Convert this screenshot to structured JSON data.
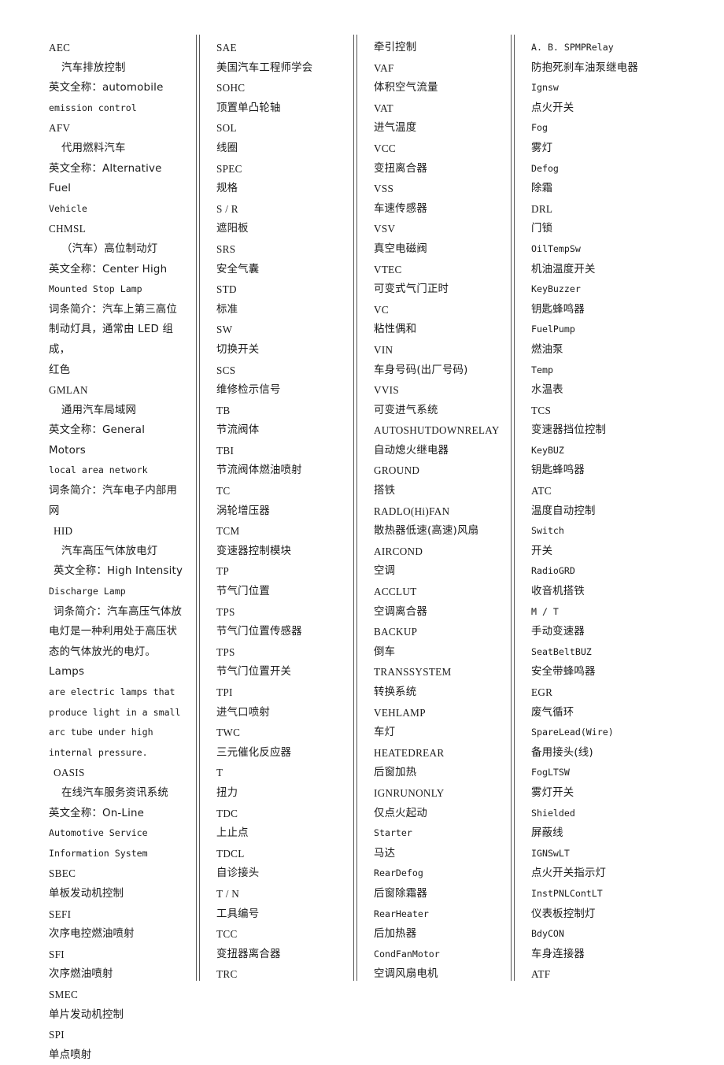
{
  "document": {
    "type": "glossary",
    "title": "汽车英文缩写词汇表",
    "column_count": 4
  },
  "columns": [
    {
      "id": "column-1",
      "lines": [
        {
          "text": "AEC",
          "style": "term",
          "indent": 1
        },
        {
          "text": "汽车排放控制",
          "style": "cn",
          "indent": 2
        },
        {
          "text": "英文全称：automobile",
          "style": "mixed",
          "indent": 1
        },
        {
          "text": "emission control",
          "style": "mono",
          "indent": 1
        },
        {
          "text": "AFV",
          "style": "term",
          "indent": 1
        },
        {
          "text": "代用燃料汽车",
          "style": "cn",
          "indent": 2
        },
        {
          "text": "英文全称：Alternative Fuel",
          "style": "mixed",
          "indent": 1
        },
        {
          "text": "Vehicle",
          "style": "mono",
          "indent": 1
        },
        {
          "text": "CHMSL",
          "style": "term",
          "indent": 1
        },
        {
          "text": "（汽车）高位制动灯",
          "style": "cn",
          "indent": 2
        },
        {
          "text": "英文全称：Center High",
          "style": "mixed",
          "indent": 1
        },
        {
          "text": "Mounted Stop Lamp",
          "style": "mono",
          "indent": 1
        },
        {
          "text": "词条简介：汽车上第三高位",
          "style": "cn",
          "indent": 1
        },
        {
          "text": "制动灯具，通常由 LED 组成，",
          "style": "cn",
          "indent": 1
        },
        {
          "text": "红色",
          "style": "cn",
          "indent": 1
        },
        {
          "text": "GMLAN",
          "style": "term",
          "indent": 1
        },
        {
          "text": "通用汽车局域网",
          "style": "cn",
          "indent": 2
        },
        {
          "text": "英文全称：General Motors",
          "style": "mixed",
          "indent": 1
        },
        {
          "text": "local area network",
          "style": "mono",
          "indent": 1
        },
        {
          "text": "词条简介：汽车电子内部用",
          "style": "cn",
          "indent": 1
        },
        {
          "text": "网",
          "style": "cn",
          "indent": 1
        },
        {
          "text": "HID",
          "style": "term",
          "indent": 3
        },
        {
          "text": "汽车高压气体放电灯",
          "style": "cn",
          "indent": 2
        },
        {
          "text": "英文全称：High Intensity",
          "style": "mixed",
          "indent": 3
        },
        {
          "text": "Discharge Lamp",
          "style": "mono",
          "indent": 1
        },
        {
          "text": "词条简介：汽车高压气体放",
          "style": "cn",
          "indent": 3
        },
        {
          "text": "电灯是一种利用处于高压状",
          "style": "cn",
          "indent": 1
        },
        {
          "text": "态的气体放光的电灯。Lamps",
          "style": "cn",
          "indent": 1
        },
        {
          "text": "are electric lamps that",
          "style": "mono",
          "indent": 1
        },
        {
          "text": "produce light in a small",
          "style": "mono",
          "indent": 1
        },
        {
          "text": "arc tube under high",
          "style": "mono",
          "indent": 1
        },
        {
          "text": "internal pressure.",
          "style": "mono",
          "indent": 1
        },
        {
          "text": "OASIS",
          "style": "term",
          "indent": 3
        },
        {
          "text": "在线汽车服务资讯系统",
          "style": "cn",
          "indent": 2
        },
        {
          "text": "英文全称：On-Line",
          "style": "mixed",
          "indent": 1
        },
        {
          "text": "Automotive Service",
          "style": "mono",
          "indent": 1
        },
        {
          "text": "Information System",
          "style": "mono",
          "indent": 1
        },
        {
          "text": "SBEC",
          "style": "term",
          "indent": 1
        },
        {
          "text": "单板发动机控制",
          "style": "cn",
          "indent": 1
        },
        {
          "text": "SEFI",
          "style": "term",
          "indent": 1
        },
        {
          "text": "次序电控燃油喷射",
          "style": "cn",
          "indent": 1
        },
        {
          "text": "SFI",
          "style": "term",
          "indent": 1
        },
        {
          "text": "次序燃油喷射",
          "style": "cn",
          "indent": 1
        },
        {
          "text": "SMEC",
          "style": "term",
          "indent": 1
        },
        {
          "text": "单片发动机控制",
          "style": "cn",
          "indent": 1
        },
        {
          "text": "SPI",
          "style": "term",
          "indent": 1
        },
        {
          "text": "单点喷射",
          "style": "cn",
          "indent": 1
        }
      ]
    },
    {
      "id": "column-2",
      "lines": [
        {
          "text": "SAE",
          "style": "term",
          "indent": 1
        },
        {
          "text": "美国汽车工程师学会",
          "style": "cn",
          "indent": 1
        },
        {
          "text": "SOHC",
          "style": "term",
          "indent": 1
        },
        {
          "text": "顶置单凸轮轴",
          "style": "cn",
          "indent": 1
        },
        {
          "text": "SOL",
          "style": "term",
          "indent": 1
        },
        {
          "text": "线圈",
          "style": "cn",
          "indent": 1
        },
        {
          "text": "SPEC",
          "style": "term",
          "indent": 1
        },
        {
          "text": "规格",
          "style": "cn",
          "indent": 1
        },
        {
          "text": "S / R",
          "style": "term",
          "indent": 1
        },
        {
          "text": "遮阳板",
          "style": "cn",
          "indent": 1
        },
        {
          "text": "SRS",
          "style": "term",
          "indent": 1
        },
        {
          "text": "安全气囊",
          "style": "cn",
          "indent": 1
        },
        {
          "text": "STD",
          "style": "term",
          "indent": 1
        },
        {
          "text": "标准",
          "style": "cn",
          "indent": 1
        },
        {
          "text": "SW",
          "style": "term",
          "indent": 1
        },
        {
          "text": "切换开关",
          "style": "cn",
          "indent": 1
        },
        {
          "text": "SCS",
          "style": "term",
          "indent": 1
        },
        {
          "text": "维修检示信号",
          "style": "cn",
          "indent": 1
        },
        {
          "text": "TB",
          "style": "term",
          "indent": 1
        },
        {
          "text": "节流阀体",
          "style": "cn",
          "indent": 1
        },
        {
          "text": "TBI",
          "style": "term",
          "indent": 1
        },
        {
          "text": "节流阀体燃油喷射",
          "style": "cn",
          "indent": 1
        },
        {
          "text": "TC",
          "style": "term",
          "indent": 1
        },
        {
          "text": "涡轮增压器",
          "style": "cn",
          "indent": 1
        },
        {
          "text": "TCM",
          "style": "term",
          "indent": 1
        },
        {
          "text": "变速器控制模块",
          "style": "cn",
          "indent": 1
        },
        {
          "text": "TP",
          "style": "term",
          "indent": 1
        },
        {
          "text": "节气门位置",
          "style": "cn",
          "indent": 1
        },
        {
          "text": "TPS",
          "style": "term",
          "indent": 1
        },
        {
          "text": "节气门位置传感器",
          "style": "cn",
          "indent": 1
        },
        {
          "text": "TPS",
          "style": "term",
          "indent": 1
        },
        {
          "text": "节气门位置开关",
          "style": "cn",
          "indent": 1
        },
        {
          "text": "TPI",
          "style": "term",
          "indent": 1
        },
        {
          "text": "进气口喷射",
          "style": "cn",
          "indent": 1
        },
        {
          "text": "TWC",
          "style": "term",
          "indent": 1
        },
        {
          "text": "三元催化反应器",
          "style": "cn",
          "indent": 1
        },
        {
          "text": "T",
          "style": "term",
          "indent": 1
        },
        {
          "text": "扭力",
          "style": "cn",
          "indent": 1
        },
        {
          "text": "TDC",
          "style": "term",
          "indent": 1
        },
        {
          "text": "上止点",
          "style": "cn",
          "indent": 1
        },
        {
          "text": "TDCL",
          "style": "term",
          "indent": 1
        },
        {
          "text": "自诊接头",
          "style": "cn",
          "indent": 1
        },
        {
          "text": "T / N",
          "style": "term",
          "indent": 1
        },
        {
          "text": "工具编号",
          "style": "cn",
          "indent": 1
        },
        {
          "text": "TCC",
          "style": "term",
          "indent": 1
        },
        {
          "text": "变扭器离合器",
          "style": "cn",
          "indent": 1
        },
        {
          "text": "TRC",
          "style": "term",
          "indent": 1
        }
      ]
    },
    {
      "id": "column-3",
      "lines": [
        {
          "text": "牵引控制",
          "style": "cn",
          "indent": 1
        },
        {
          "text": "VAF",
          "style": "term",
          "indent": 1
        },
        {
          "text": "体积空气流量",
          "style": "cn",
          "indent": 1
        },
        {
          "text": "VAT",
          "style": "term",
          "indent": 1
        },
        {
          "text": "进气温度",
          "style": "cn",
          "indent": 1
        },
        {
          "text": "VCC",
          "style": "term",
          "indent": 1
        },
        {
          "text": "变扭离合器",
          "style": "cn",
          "indent": 1
        },
        {
          "text": "VSS",
          "style": "term",
          "indent": 1
        },
        {
          "text": "车速传感器",
          "style": "cn",
          "indent": 1
        },
        {
          "text": "VSV",
          "style": "term",
          "indent": 1
        },
        {
          "text": "真空电磁阀",
          "style": "cn",
          "indent": 1
        },
        {
          "text": "VTEC",
          "style": "term",
          "indent": 1
        },
        {
          "text": "可变式气门正时",
          "style": "cn",
          "indent": 1
        },
        {
          "text": "VC",
          "style": "term",
          "indent": 1
        },
        {
          "text": "粘性偶和",
          "style": "cn",
          "indent": 1
        },
        {
          "text": "VIN",
          "style": "term",
          "indent": 1
        },
        {
          "text": "车身号码(出厂号码)",
          "style": "cn",
          "indent": 1
        },
        {
          "text": "VVIS",
          "style": "term",
          "indent": 1
        },
        {
          "text": "可变进气系统",
          "style": "cn",
          "indent": 1
        },
        {
          "text": "AUTOSHUTDOWNRELAY",
          "style": "term",
          "indent": 1
        },
        {
          "text": "自动熄火继电器",
          "style": "cn",
          "indent": 1
        },
        {
          "text": "GROUND",
          "style": "term",
          "indent": 1
        },
        {
          "text": "搭铁",
          "style": "cn",
          "indent": 1
        },
        {
          "text": "RADLO(Hi)FAN",
          "style": "term",
          "indent": 1
        },
        {
          "text": "散热器低速(高速)风扇",
          "style": "cn",
          "indent": 1
        },
        {
          "text": "AIRCOND",
          "style": "term",
          "indent": 1
        },
        {
          "text": "空调",
          "style": "cn",
          "indent": 1
        },
        {
          "text": "ACCLUT",
          "style": "term",
          "indent": 1
        },
        {
          "text": "空调离合器",
          "style": "cn",
          "indent": 1
        },
        {
          "text": "BACKUP",
          "style": "term",
          "indent": 1
        },
        {
          "text": "倒车",
          "style": "cn",
          "indent": 1
        },
        {
          "text": "TRANSSYSTEM",
          "style": "term",
          "indent": 1
        },
        {
          "text": "转换系统",
          "style": "cn",
          "indent": 1
        },
        {
          "text": "VEHLAMP",
          "style": "term",
          "indent": 1
        },
        {
          "text": "车灯",
          "style": "cn",
          "indent": 1
        },
        {
          "text": "HEATEDREAR",
          "style": "term",
          "indent": 1
        },
        {
          "text": "后窗加热",
          "style": "cn",
          "indent": 1
        },
        {
          "text": "IGNRUNONLY",
          "style": "term",
          "indent": 1
        },
        {
          "text": "仅点火起动",
          "style": "cn",
          "indent": 1
        },
        {
          "text": "Starter",
          "style": "mono",
          "indent": 1
        },
        {
          "text": "马达",
          "style": "cn",
          "indent": 1
        },
        {
          "text": "RearDefog",
          "style": "mono",
          "indent": 1
        },
        {
          "text": "后窗除霜器",
          "style": "cn",
          "indent": 1
        },
        {
          "text": "RearHeater",
          "style": "mono",
          "indent": 1
        },
        {
          "text": "后加热器",
          "style": "cn",
          "indent": 1
        },
        {
          "text": "CondFanMotor",
          "style": "mono",
          "indent": 1
        },
        {
          "text": "空调风扇电机",
          "style": "cn",
          "indent": 1
        }
      ]
    },
    {
      "id": "column-4",
      "lines": [
        {
          "text": "A. B. SPMPRelay",
          "style": "mono",
          "indent": 1
        },
        {
          "text": "防抱死刹车油泵继电器",
          "style": "cn",
          "indent": 1
        },
        {
          "text": "Ignsw",
          "style": "mono",
          "indent": 1
        },
        {
          "text": "点火开关",
          "style": "cn",
          "indent": 1
        },
        {
          "text": "Fog",
          "style": "mono",
          "indent": 1
        },
        {
          "text": "雾灯",
          "style": "cn",
          "indent": 1
        },
        {
          "text": "Defog",
          "style": "mono",
          "indent": 1
        },
        {
          "text": "除霜",
          "style": "cn",
          "indent": 1
        },
        {
          "text": "DRL",
          "style": "term",
          "indent": 1
        },
        {
          "text": "门锁",
          "style": "cn",
          "indent": 1
        },
        {
          "text": "OilTempSw",
          "style": "mono",
          "indent": 1
        },
        {
          "text": "机油温度开关",
          "style": "cn",
          "indent": 1
        },
        {
          "text": "KeyBuzzer",
          "style": "mono",
          "indent": 1
        },
        {
          "text": "钥匙蜂鸣器",
          "style": "cn",
          "indent": 1
        },
        {
          "text": "FuelPump",
          "style": "mono",
          "indent": 1
        },
        {
          "text": "燃油泵",
          "style": "cn",
          "indent": 1
        },
        {
          "text": "Temp",
          "style": "mono",
          "indent": 1
        },
        {
          "text": "水温表",
          "style": "cn",
          "indent": 1
        },
        {
          "text": "TCS",
          "style": "term",
          "indent": 1
        },
        {
          "text": "变速器挡位控制",
          "style": "cn",
          "indent": 1
        },
        {
          "text": "KeyBUZ",
          "style": "mono",
          "indent": 1
        },
        {
          "text": "钥匙蜂鸣器",
          "style": "cn",
          "indent": 1
        },
        {
          "text": "ATC",
          "style": "term",
          "indent": 1
        },
        {
          "text": "温度自动控制",
          "style": "cn",
          "indent": 1
        },
        {
          "text": "Switch",
          "style": "mono",
          "indent": 1
        },
        {
          "text": "开关",
          "style": "cn",
          "indent": 1
        },
        {
          "text": "RadioGRD",
          "style": "mono",
          "indent": 1
        },
        {
          "text": "收音机搭铁",
          "style": "cn",
          "indent": 1
        },
        {
          "text": "M / T",
          "style": "mono",
          "indent": 1
        },
        {
          "text": "手动变速器",
          "style": "cn",
          "indent": 1
        },
        {
          "text": "SeatBeltBUZ",
          "style": "mono",
          "indent": 1
        },
        {
          "text": "安全带蜂鸣器",
          "style": "cn",
          "indent": 1
        },
        {
          "text": "EGR",
          "style": "term",
          "indent": 1
        },
        {
          "text": "废气循环",
          "style": "cn",
          "indent": 1
        },
        {
          "text": "SpareLead(Wire)",
          "style": "mono",
          "indent": 1
        },
        {
          "text": "备用接头(线)",
          "style": "cn",
          "indent": 1
        },
        {
          "text": "FogLTSW",
          "style": "mono",
          "indent": 1
        },
        {
          "text": "雾灯开关",
          "style": "cn",
          "indent": 1
        },
        {
          "text": "Shielded",
          "style": "mono",
          "indent": 1
        },
        {
          "text": "屏蔽线",
          "style": "cn",
          "indent": 1
        },
        {
          "text": "IGNSwLT",
          "style": "mono",
          "indent": 1
        },
        {
          "text": "点火开关指示灯",
          "style": "cn",
          "indent": 1
        },
        {
          "text": "InstPNLContLT",
          "style": "mono",
          "indent": 1
        },
        {
          "text": "仪表板控制灯",
          "style": "cn",
          "indent": 1
        },
        {
          "text": "BdyCON",
          "style": "mono",
          "indent": 1
        },
        {
          "text": "车身连接器",
          "style": "cn",
          "indent": 1
        },
        {
          "text": "ATF",
          "style": "term",
          "indent": 1
        }
      ]
    }
  ]
}
